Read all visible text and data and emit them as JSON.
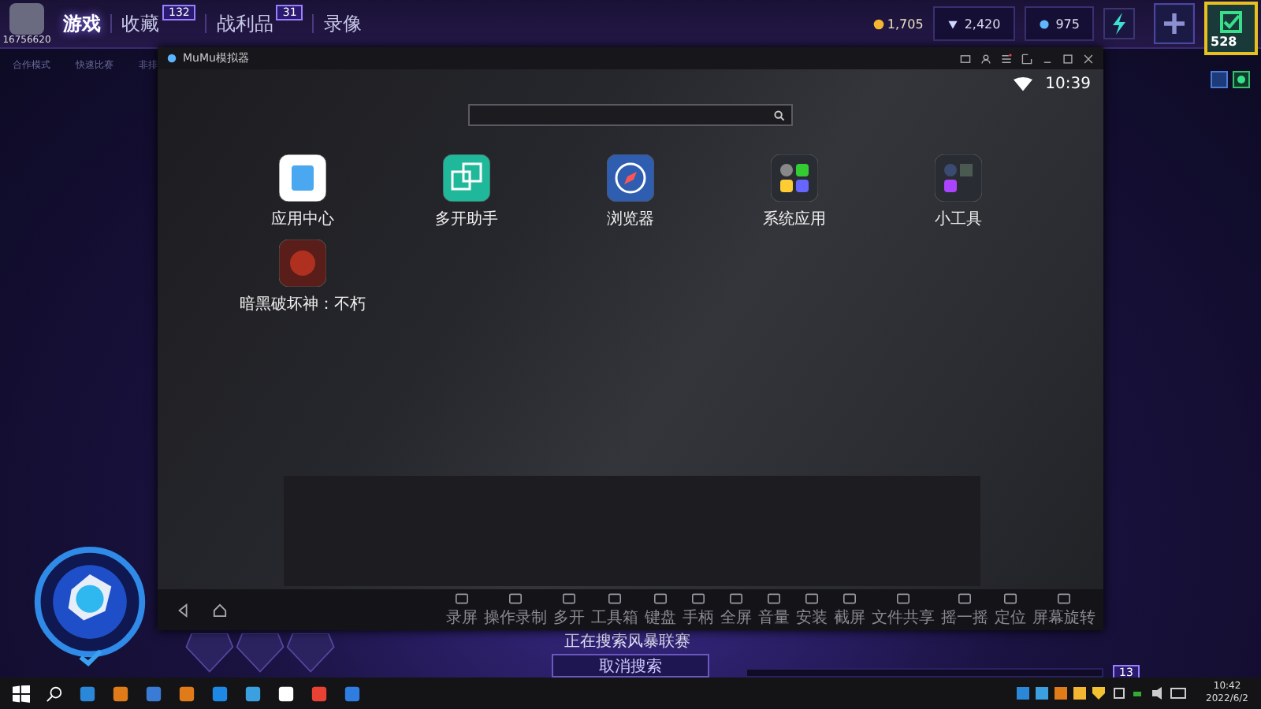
{
  "game": {
    "player_id": "16756620",
    "nav": [
      {
        "label": "游戏",
        "selected": true
      },
      {
        "label": "收藏",
        "selected": false,
        "badge": "132"
      },
      {
        "label": "战利品",
        "selected": false,
        "badge": "31"
      },
      {
        "label": "录像",
        "selected": false
      }
    ],
    "subnav": [
      "合作模式",
      "快速比赛",
      "非排"
    ],
    "currency": {
      "gold": "1,705",
      "gems": "2,420",
      "shards": "975"
    },
    "profile_level": "528",
    "party_badge": "13",
    "search_status": "正在搜索风暴联赛",
    "cancel_button": "取消搜索"
  },
  "emulator": {
    "title": "MuMu模拟器",
    "time": "10:39",
    "apps": [
      {
        "label": "应用中心",
        "kind": "store"
      },
      {
        "label": "多开助手",
        "kind": "multi"
      },
      {
        "label": "浏览器",
        "kind": "browser"
      },
      {
        "label": "系统应用",
        "kind": "folder"
      },
      {
        "label": "小工具",
        "kind": "tools"
      },
      {
        "label": "暗黑破坏神：不朽",
        "kind": "game"
      }
    ],
    "toolbar": [
      "录屏",
      "操作录制",
      "多开",
      "工具箱",
      "键盘",
      "手柄",
      "全屏",
      "音量",
      "安装",
      "截屏",
      "文件共享",
      "摇一摇",
      "定位",
      "屏幕旋转"
    ]
  },
  "taskbar": {
    "time": "10:42",
    "date": "2022/6/2"
  }
}
